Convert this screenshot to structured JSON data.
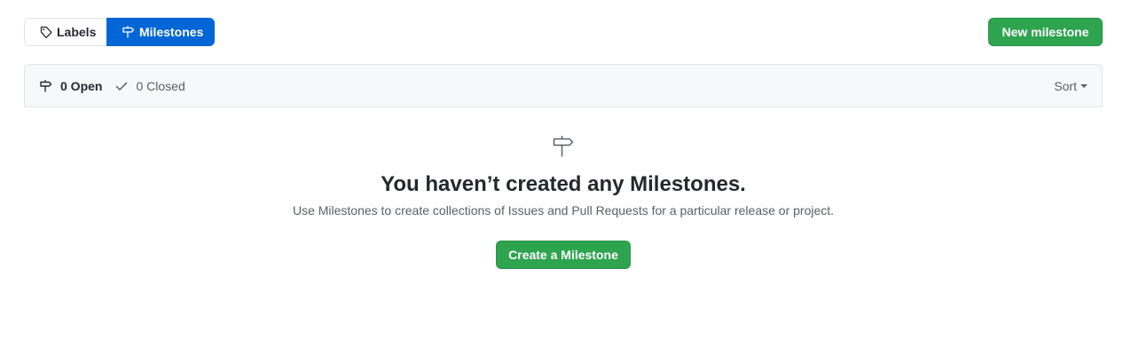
{
  "subnav": {
    "labels_label": "Labels",
    "milestones_label": "Milestones",
    "labels_icon": "tag-icon",
    "milestones_icon": "milestone-icon",
    "active": "milestones"
  },
  "toolbar": {
    "new_milestone_label": "New milestone"
  },
  "filters": {
    "open_label": "0 Open",
    "closed_label": "0 Closed",
    "open_icon": "milestone-icon",
    "closed_icon": "check-icon",
    "sort_label": "Sort"
  },
  "blankslate": {
    "icon": "milestone-icon",
    "title": "You haven’t created any Milestones.",
    "description": "Use Milestones to create collections of Issues and Pull Requests for a particular release or project.",
    "button_label": "Create a Milestone"
  },
  "colors": {
    "primary_green": "#2ea44f",
    "active_blue": "#0366d6",
    "header_bg": "#f6f8fa",
    "border": "#e1e4e8",
    "muted_text": "#586069"
  }
}
